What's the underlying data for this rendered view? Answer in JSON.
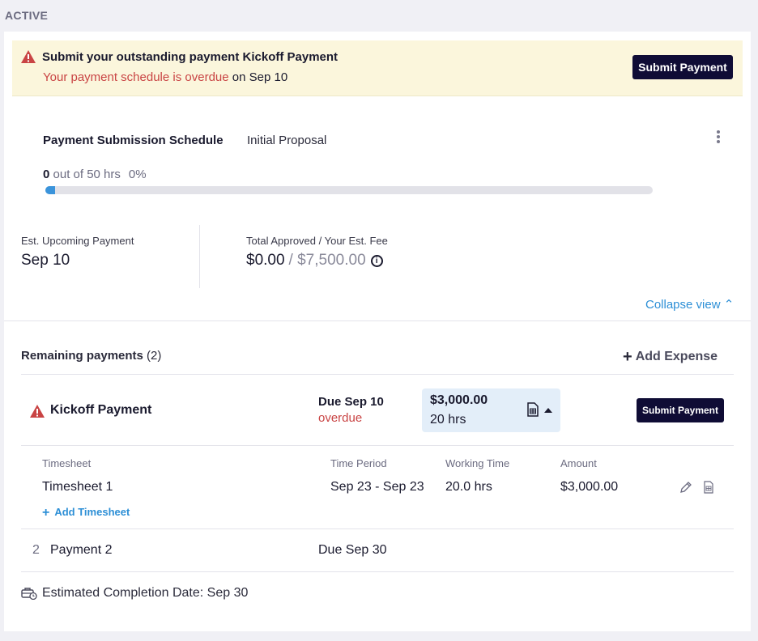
{
  "section_label": "ACTIVE",
  "alert": {
    "title": "Submit your outstanding payment Kickoff Payment",
    "sub_red": "Your payment schedule is overdue",
    "sub_rest": " on Sep 10",
    "button": "Submit Payment"
  },
  "schedule": {
    "title": "Payment Submission Schedule",
    "name": "Initial Proposal",
    "progress_done": "0",
    "progress_rest": " out of 50 hrs",
    "progress_pct": "0%",
    "progress_fraction": 0.0
  },
  "summary": {
    "upcoming_label": "Est. Upcoming Payment",
    "upcoming_value": "Sep 10",
    "total_label": "Total Approved / Your Est. Fee",
    "total_approved": "$0.00",
    "total_fee": "/ $7,500.00",
    "info_glyph": "i"
  },
  "collapse_label": "Collapse view ⌃",
  "remaining": {
    "label": "Remaining payments",
    "count": "(2)",
    "add_expense": "Add Expense",
    "plus": "+"
  },
  "payment1": {
    "name": "Kickoff Payment",
    "due": "Due Sep 10",
    "status": "overdue",
    "amount": "$3,000.00",
    "hours": "20 hrs",
    "button": "Submit Payment",
    "columns": [
      "Timesheet",
      "Time Period",
      "Working Time",
      "Amount"
    ],
    "rows": [
      {
        "timesheet": "Timesheet 1",
        "period": "Sep 23 - Sep 23",
        "working": "20.0 hrs",
        "amount": "$3,000.00"
      }
    ],
    "add_timesheet": "Add Timesheet",
    "add_plus": "+"
  },
  "payment2": {
    "number": "2",
    "name": "Payment 2",
    "due": "Due Sep 30"
  },
  "completion": "Estimated Completion Date: Sep 30",
  "colors": {
    "accent": "#2d8fd6",
    "dark_button": "#0f0c35",
    "alert_bg": "#fbf6dc",
    "danger": "#c94444",
    "progress": "#3b94db"
  },
  "icons": [
    "warning-icon",
    "kebab-menu-icon",
    "info-icon",
    "plus-icon",
    "document-icon",
    "caret-up-icon",
    "pencil-icon",
    "briefcase-clock-icon"
  ]
}
